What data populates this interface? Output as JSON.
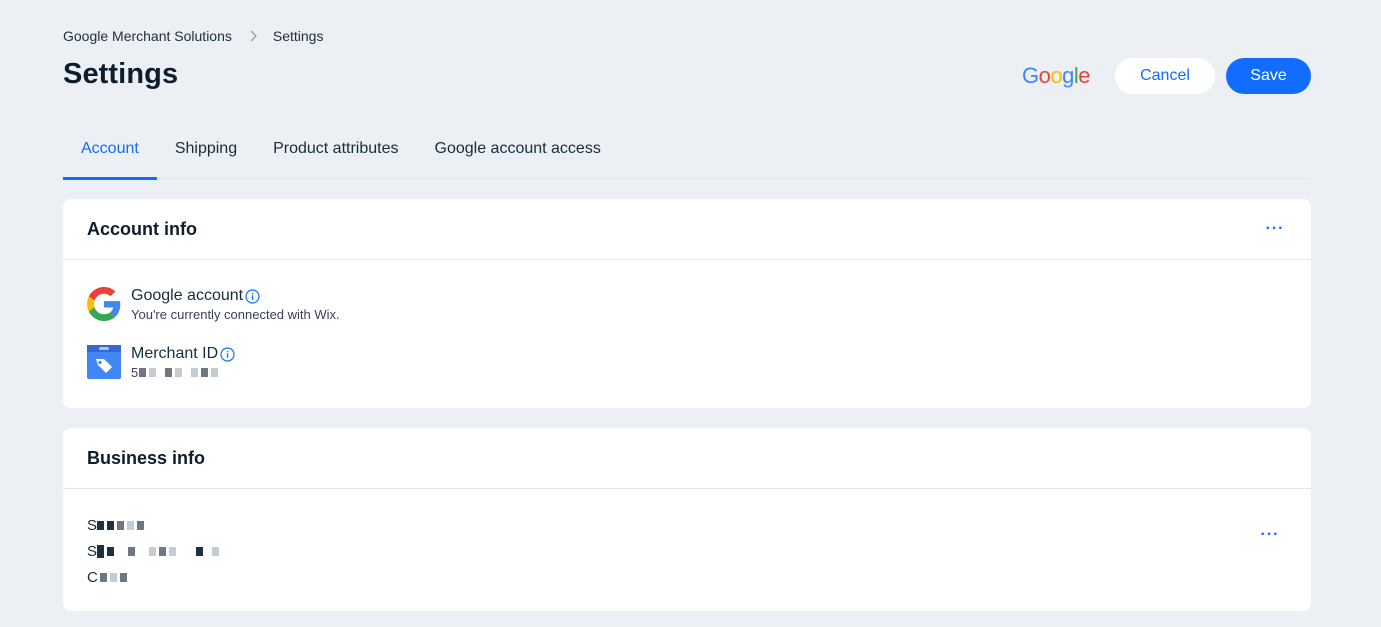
{
  "breadcrumb": {
    "root": "Google Merchant Solutions",
    "current": "Settings"
  },
  "page": {
    "title": "Settings"
  },
  "header": {
    "brand": "Google",
    "cancel_label": "Cancel",
    "save_label": "Save"
  },
  "tabs": [
    {
      "label": "Account",
      "active": true
    },
    {
      "label": "Shipping",
      "active": false
    },
    {
      "label": "Product attributes",
      "active": false
    },
    {
      "label": "Google account access",
      "active": false
    }
  ],
  "account_info": {
    "title": "Account info",
    "more_label": "···",
    "google_account": {
      "label": "Google account",
      "description": "You're currently connected with Wix."
    },
    "merchant_id": {
      "label": "Merchant ID",
      "value_visible": "5"
    }
  },
  "business_info": {
    "title": "Business info",
    "more_label": "···",
    "address_lines_visible": [
      "S",
      "S",
      "C"
    ]
  },
  "colors": {
    "accent": "#116dff",
    "background": "#ecf0f4",
    "card": "#ffffff",
    "text": "#162d3d"
  }
}
